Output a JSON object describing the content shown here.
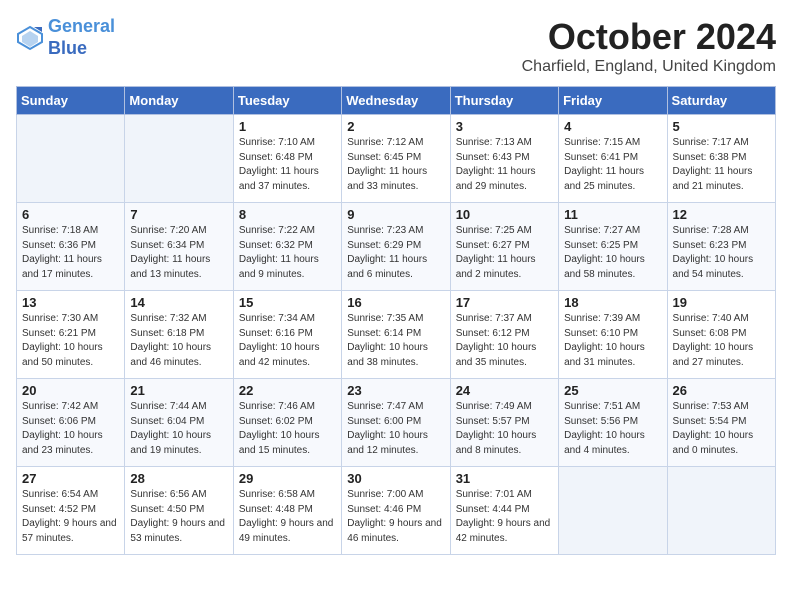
{
  "header": {
    "logo_line1": "General",
    "logo_line2": "Blue",
    "month_title": "October 2024",
    "subtitle": "Charfield, England, United Kingdom"
  },
  "days_of_week": [
    "Sunday",
    "Monday",
    "Tuesday",
    "Wednesday",
    "Thursday",
    "Friday",
    "Saturday"
  ],
  "weeks": [
    [
      {
        "day": "",
        "content": ""
      },
      {
        "day": "",
        "content": ""
      },
      {
        "day": "1",
        "content": "Sunrise: 7:10 AM\nSunset: 6:48 PM\nDaylight: 11 hours and 37 minutes."
      },
      {
        "day": "2",
        "content": "Sunrise: 7:12 AM\nSunset: 6:45 PM\nDaylight: 11 hours and 33 minutes."
      },
      {
        "day": "3",
        "content": "Sunrise: 7:13 AM\nSunset: 6:43 PM\nDaylight: 11 hours and 29 minutes."
      },
      {
        "day": "4",
        "content": "Sunrise: 7:15 AM\nSunset: 6:41 PM\nDaylight: 11 hours and 25 minutes."
      },
      {
        "day": "5",
        "content": "Sunrise: 7:17 AM\nSunset: 6:38 PM\nDaylight: 11 hours and 21 minutes."
      }
    ],
    [
      {
        "day": "6",
        "content": "Sunrise: 7:18 AM\nSunset: 6:36 PM\nDaylight: 11 hours and 17 minutes."
      },
      {
        "day": "7",
        "content": "Sunrise: 7:20 AM\nSunset: 6:34 PM\nDaylight: 11 hours and 13 minutes."
      },
      {
        "day": "8",
        "content": "Sunrise: 7:22 AM\nSunset: 6:32 PM\nDaylight: 11 hours and 9 minutes."
      },
      {
        "day": "9",
        "content": "Sunrise: 7:23 AM\nSunset: 6:29 PM\nDaylight: 11 hours and 6 minutes."
      },
      {
        "day": "10",
        "content": "Sunrise: 7:25 AM\nSunset: 6:27 PM\nDaylight: 11 hours and 2 minutes."
      },
      {
        "day": "11",
        "content": "Sunrise: 7:27 AM\nSunset: 6:25 PM\nDaylight: 10 hours and 58 minutes."
      },
      {
        "day": "12",
        "content": "Sunrise: 7:28 AM\nSunset: 6:23 PM\nDaylight: 10 hours and 54 minutes."
      }
    ],
    [
      {
        "day": "13",
        "content": "Sunrise: 7:30 AM\nSunset: 6:21 PM\nDaylight: 10 hours and 50 minutes."
      },
      {
        "day": "14",
        "content": "Sunrise: 7:32 AM\nSunset: 6:18 PM\nDaylight: 10 hours and 46 minutes."
      },
      {
        "day": "15",
        "content": "Sunrise: 7:34 AM\nSunset: 6:16 PM\nDaylight: 10 hours and 42 minutes."
      },
      {
        "day": "16",
        "content": "Sunrise: 7:35 AM\nSunset: 6:14 PM\nDaylight: 10 hours and 38 minutes."
      },
      {
        "day": "17",
        "content": "Sunrise: 7:37 AM\nSunset: 6:12 PM\nDaylight: 10 hours and 35 minutes."
      },
      {
        "day": "18",
        "content": "Sunrise: 7:39 AM\nSunset: 6:10 PM\nDaylight: 10 hours and 31 minutes."
      },
      {
        "day": "19",
        "content": "Sunrise: 7:40 AM\nSunset: 6:08 PM\nDaylight: 10 hours and 27 minutes."
      }
    ],
    [
      {
        "day": "20",
        "content": "Sunrise: 7:42 AM\nSunset: 6:06 PM\nDaylight: 10 hours and 23 minutes."
      },
      {
        "day": "21",
        "content": "Sunrise: 7:44 AM\nSunset: 6:04 PM\nDaylight: 10 hours and 19 minutes."
      },
      {
        "day": "22",
        "content": "Sunrise: 7:46 AM\nSunset: 6:02 PM\nDaylight: 10 hours and 15 minutes."
      },
      {
        "day": "23",
        "content": "Sunrise: 7:47 AM\nSunset: 6:00 PM\nDaylight: 10 hours and 12 minutes."
      },
      {
        "day": "24",
        "content": "Sunrise: 7:49 AM\nSunset: 5:57 PM\nDaylight: 10 hours and 8 minutes."
      },
      {
        "day": "25",
        "content": "Sunrise: 7:51 AM\nSunset: 5:56 PM\nDaylight: 10 hours and 4 minutes."
      },
      {
        "day": "26",
        "content": "Sunrise: 7:53 AM\nSunset: 5:54 PM\nDaylight: 10 hours and 0 minutes."
      }
    ],
    [
      {
        "day": "27",
        "content": "Sunrise: 6:54 AM\nSunset: 4:52 PM\nDaylight: 9 hours and 57 minutes."
      },
      {
        "day": "28",
        "content": "Sunrise: 6:56 AM\nSunset: 4:50 PM\nDaylight: 9 hours and 53 minutes."
      },
      {
        "day": "29",
        "content": "Sunrise: 6:58 AM\nSunset: 4:48 PM\nDaylight: 9 hours and 49 minutes."
      },
      {
        "day": "30",
        "content": "Sunrise: 7:00 AM\nSunset: 4:46 PM\nDaylight: 9 hours and 46 minutes."
      },
      {
        "day": "31",
        "content": "Sunrise: 7:01 AM\nSunset: 4:44 PM\nDaylight: 9 hours and 42 minutes."
      },
      {
        "day": "",
        "content": ""
      },
      {
        "day": "",
        "content": ""
      }
    ]
  ]
}
